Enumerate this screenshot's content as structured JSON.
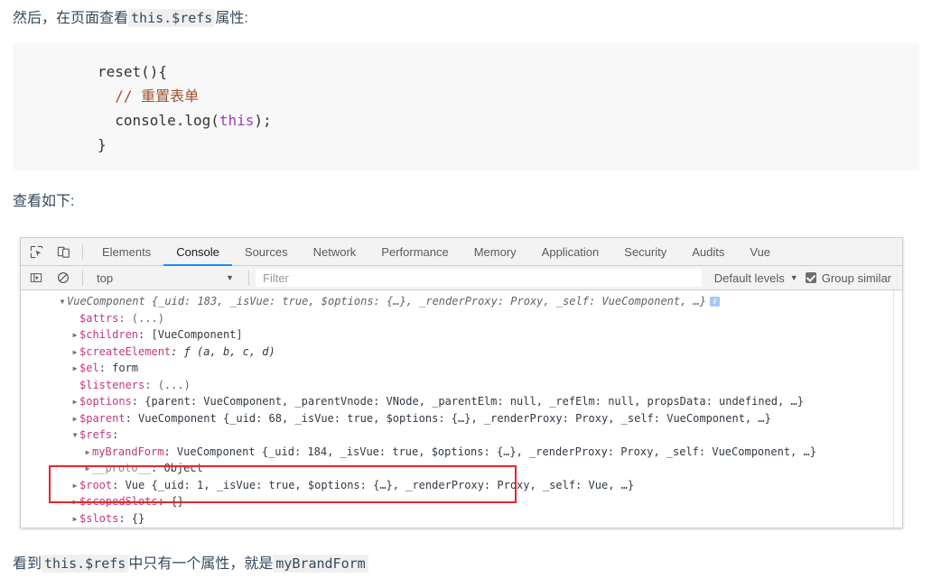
{
  "article": {
    "intro_prefix": "然后，在页面查看",
    "intro_code": "this.$refs",
    "intro_suffix": "属性:",
    "mid_text": "查看如下:",
    "outro_prefix": "看到",
    "outro_code1": "this.$refs",
    "outro_middle": "中只有一个属性，就是",
    "outro_code2": "myBrandForm"
  },
  "code_block": {
    "line1": "reset(){",
    "line2_comment": "// 重置表单",
    "line3_a": "console.log(",
    "line3_kw": "this",
    "line3_b": ");",
    "line4": "}"
  },
  "devtools": {
    "icons": {
      "inspect": "inspect-element-icon",
      "device": "device-toolbar-icon",
      "sidebar": "console-sidebar-icon",
      "clear": "clear-console-icon"
    },
    "tabs": [
      {
        "label": "Elements",
        "active": false
      },
      {
        "label": "Console",
        "active": true
      },
      {
        "label": "Sources",
        "active": false
      },
      {
        "label": "Network",
        "active": false
      },
      {
        "label": "Performance",
        "active": false
      },
      {
        "label": "Memory",
        "active": false
      },
      {
        "label": "Application",
        "active": false
      },
      {
        "label": "Security",
        "active": false
      },
      {
        "label": "Audits",
        "active": false
      },
      {
        "label": "Vue",
        "active": false
      }
    ],
    "filterbar": {
      "context": "top",
      "context_caret": "▼",
      "filter_placeholder": "Filter",
      "levels_label": "Default levels",
      "levels_caret": "▼",
      "group_similar_label": "Group similar",
      "group_similar_checked": true
    },
    "console_rows": [
      {
        "id": "root",
        "indent": 0,
        "triangle": "▼",
        "text": "VueComponent {_uid: 183, _isVue: true, $options: {…}, _renderProxy: Proxy, _self: VueComponent, …}",
        "badge": "i"
      },
      {
        "id": "attrs",
        "indent": 1,
        "triangle": "",
        "key": "$attrs",
        "value": ": (...)"
      },
      {
        "id": "children",
        "indent": 1,
        "triangle": "▶",
        "key": "$children",
        "value": ": [VueComponent]"
      },
      {
        "id": "createElement",
        "indent": 1,
        "triangle": "▶",
        "key": "$createElement",
        "value": ": ƒ (a, b, c, d)"
      },
      {
        "id": "el",
        "indent": 1,
        "triangle": "▶",
        "key": "$el",
        "value": ": form"
      },
      {
        "id": "listeners",
        "indent": 1,
        "triangle": "",
        "key": "$listeners",
        "value": ": (...)"
      },
      {
        "id": "options",
        "indent": 1,
        "triangle": "▶",
        "key": "$options",
        "value": ": {parent: VueComponent, _parentVnode: VNode, _parentElm: null, _refElm: null, propsData: undefined, …}"
      },
      {
        "id": "parent",
        "indent": 1,
        "triangle": "▶",
        "key": "$parent",
        "value": ": VueComponent {_uid: 68, _isVue: true, $options: {…}, _renderProxy: Proxy, _self: VueComponent, …}"
      },
      {
        "id": "refs",
        "indent": 1,
        "triangle": "▼",
        "key": "$refs",
        "value": ":"
      },
      {
        "id": "myBrandForm",
        "indent": 2,
        "triangle": "▶",
        "key": "myBrandForm",
        "value": ": VueComponent {_uid: 184, _isVue: true, $options: {…}, _renderProxy: Proxy, _self: VueComponent, …}"
      },
      {
        "id": "proto",
        "indent": 2,
        "triangle": "▶",
        "key": "__proto__",
        "value": ": Object"
      },
      {
        "id": "root2",
        "indent": 1,
        "triangle": "▶",
        "key": "$root",
        "value": ": Vue {_uid: 1, _isVue: true, $options: {…}, _renderProxy: Proxy, _self: Vue, …}"
      },
      {
        "id": "scopedSlots",
        "indent": 1,
        "triangle": "▶",
        "key": "$scopedSlots",
        "value": ": {}"
      },
      {
        "id": "slots",
        "indent": 1,
        "triangle": "▶",
        "key": "$slots",
        "value": ": {}"
      }
    ],
    "annotation": {
      "color": "#e8252a",
      "target": "$refs"
    }
  }
}
